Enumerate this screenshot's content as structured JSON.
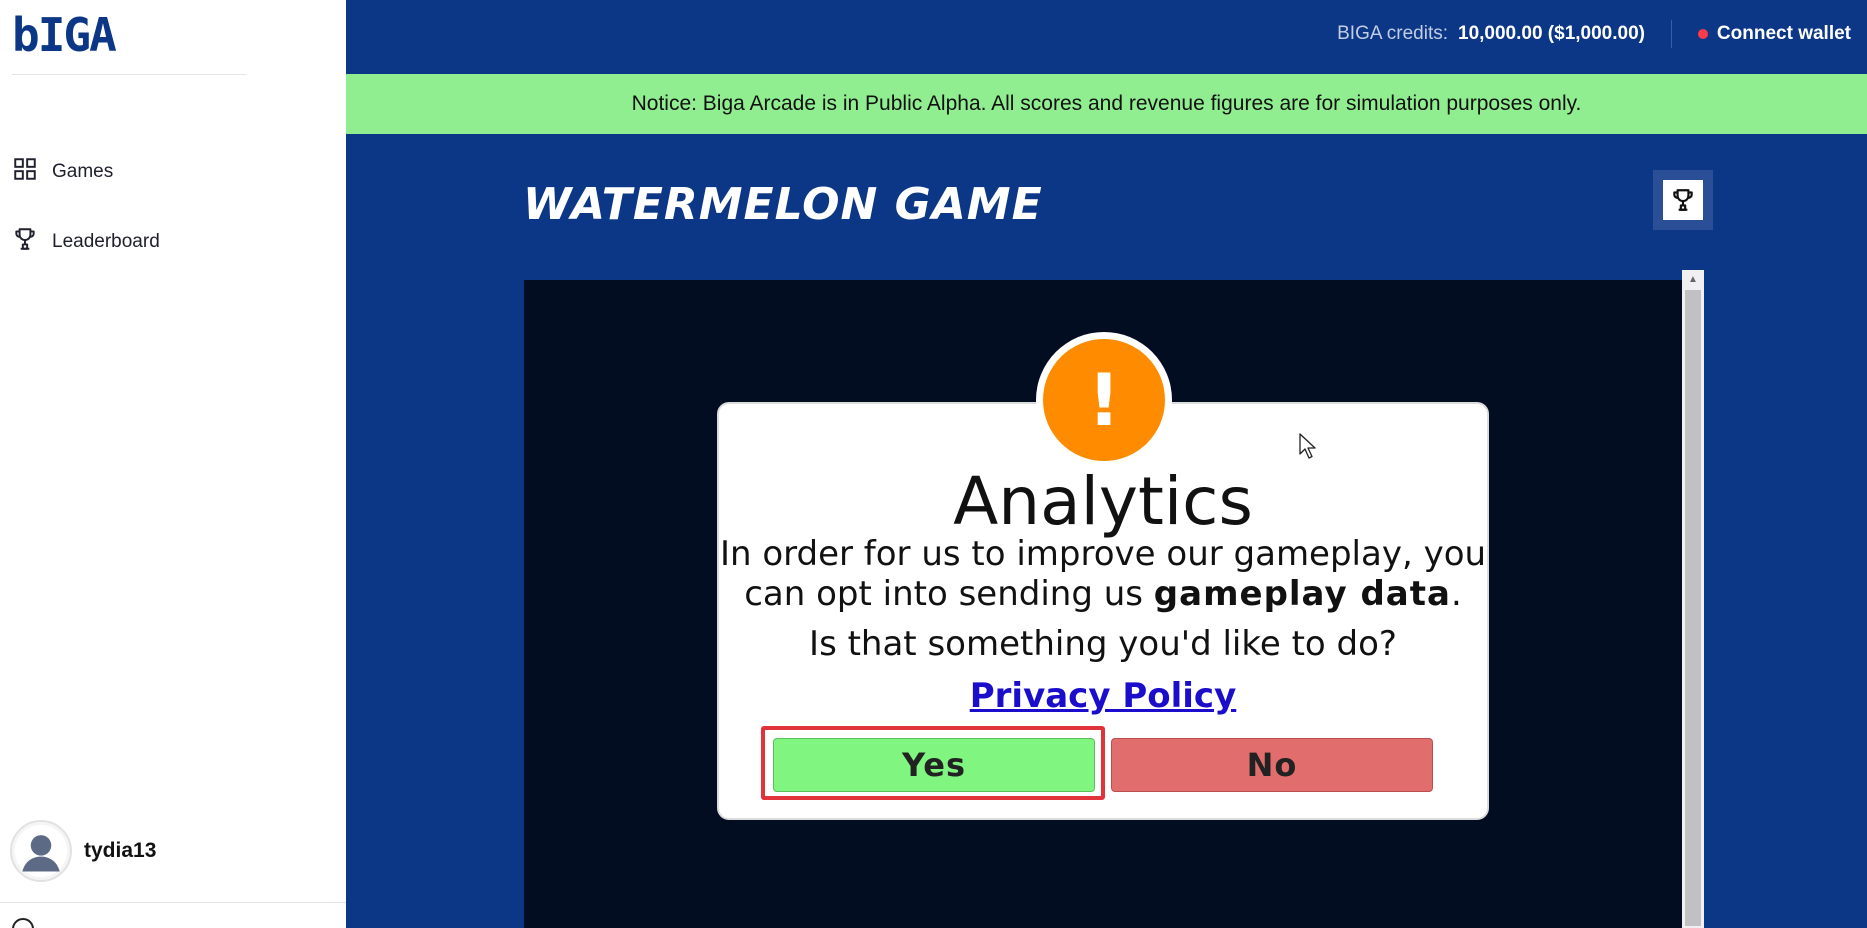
{
  "sidebar": {
    "logo": "bIGA",
    "nav": [
      {
        "label": "Games",
        "icon": "grid-icon"
      },
      {
        "label": "Leaderboard",
        "icon": "trophy-icon"
      }
    ],
    "user": {
      "name": "tydia13",
      "icon": "avatar-icon"
    }
  },
  "topbar": {
    "credits_label": "BIGA credits:",
    "credits_value": "10,000.00 ($1,000.00)",
    "wallet_label": "Connect wallet",
    "wallet_status_color": "#ff3b4a"
  },
  "notice": {
    "text": "Notice: Biga Arcade is in Public Alpha. All scores and revenue figures are for simulation purposes only.",
    "color": "#90ee90"
  },
  "game": {
    "title": "WATERMELON GAME",
    "leaderboard_icon": "trophy-icon"
  },
  "dialog": {
    "icon_symbol": "!",
    "icon_color": "#ff8c00",
    "title": "Analytics",
    "body_line1": "In order for us to improve our gameplay, you",
    "body_line2_prefix": "can opt into sending us ",
    "body_line2_bold": "gameplay data",
    "body_line2_suffix": ".",
    "question": "Is that something you'd like to do?",
    "privacy_link": "Privacy Policy",
    "yes_label": "Yes",
    "no_label": "No",
    "yes_color": "#80f580",
    "no_color": "#e26d6d"
  },
  "colors": {
    "brand_blue": "#0b3786",
    "game_bg": "#020d22"
  }
}
